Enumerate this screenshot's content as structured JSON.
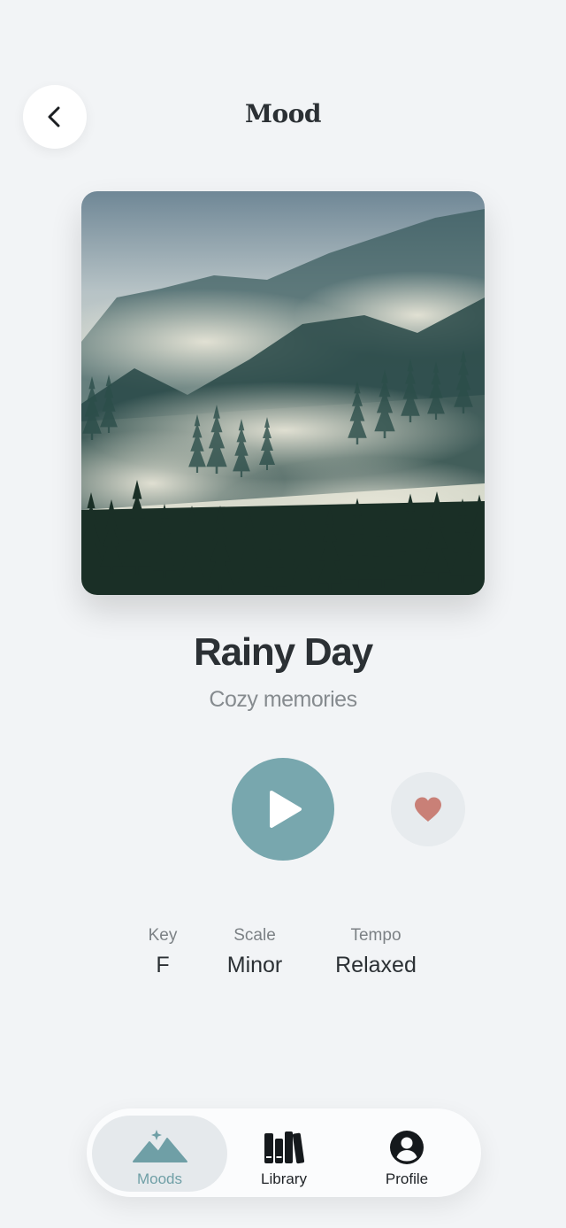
{
  "header": {
    "title": "Mood"
  },
  "track": {
    "title": "Rainy Day",
    "subtitle": "Cozy memories"
  },
  "attributes": [
    {
      "label": "Key",
      "value": "F"
    },
    {
      "label": "Scale",
      "value": "Minor"
    },
    {
      "label": "Tempo",
      "value": "Relaxed"
    }
  ],
  "tabs": [
    {
      "label": "Moods",
      "icon": "mountains-sparkle-icon",
      "active": true
    },
    {
      "label": "Library",
      "icon": "books-icon",
      "active": false
    },
    {
      "label": "Profile",
      "icon": "person-circle-icon",
      "active": false
    }
  ],
  "colors": {
    "accent": "#78a7ae",
    "favorite": "#c98077",
    "background": "#f2f4f6"
  }
}
